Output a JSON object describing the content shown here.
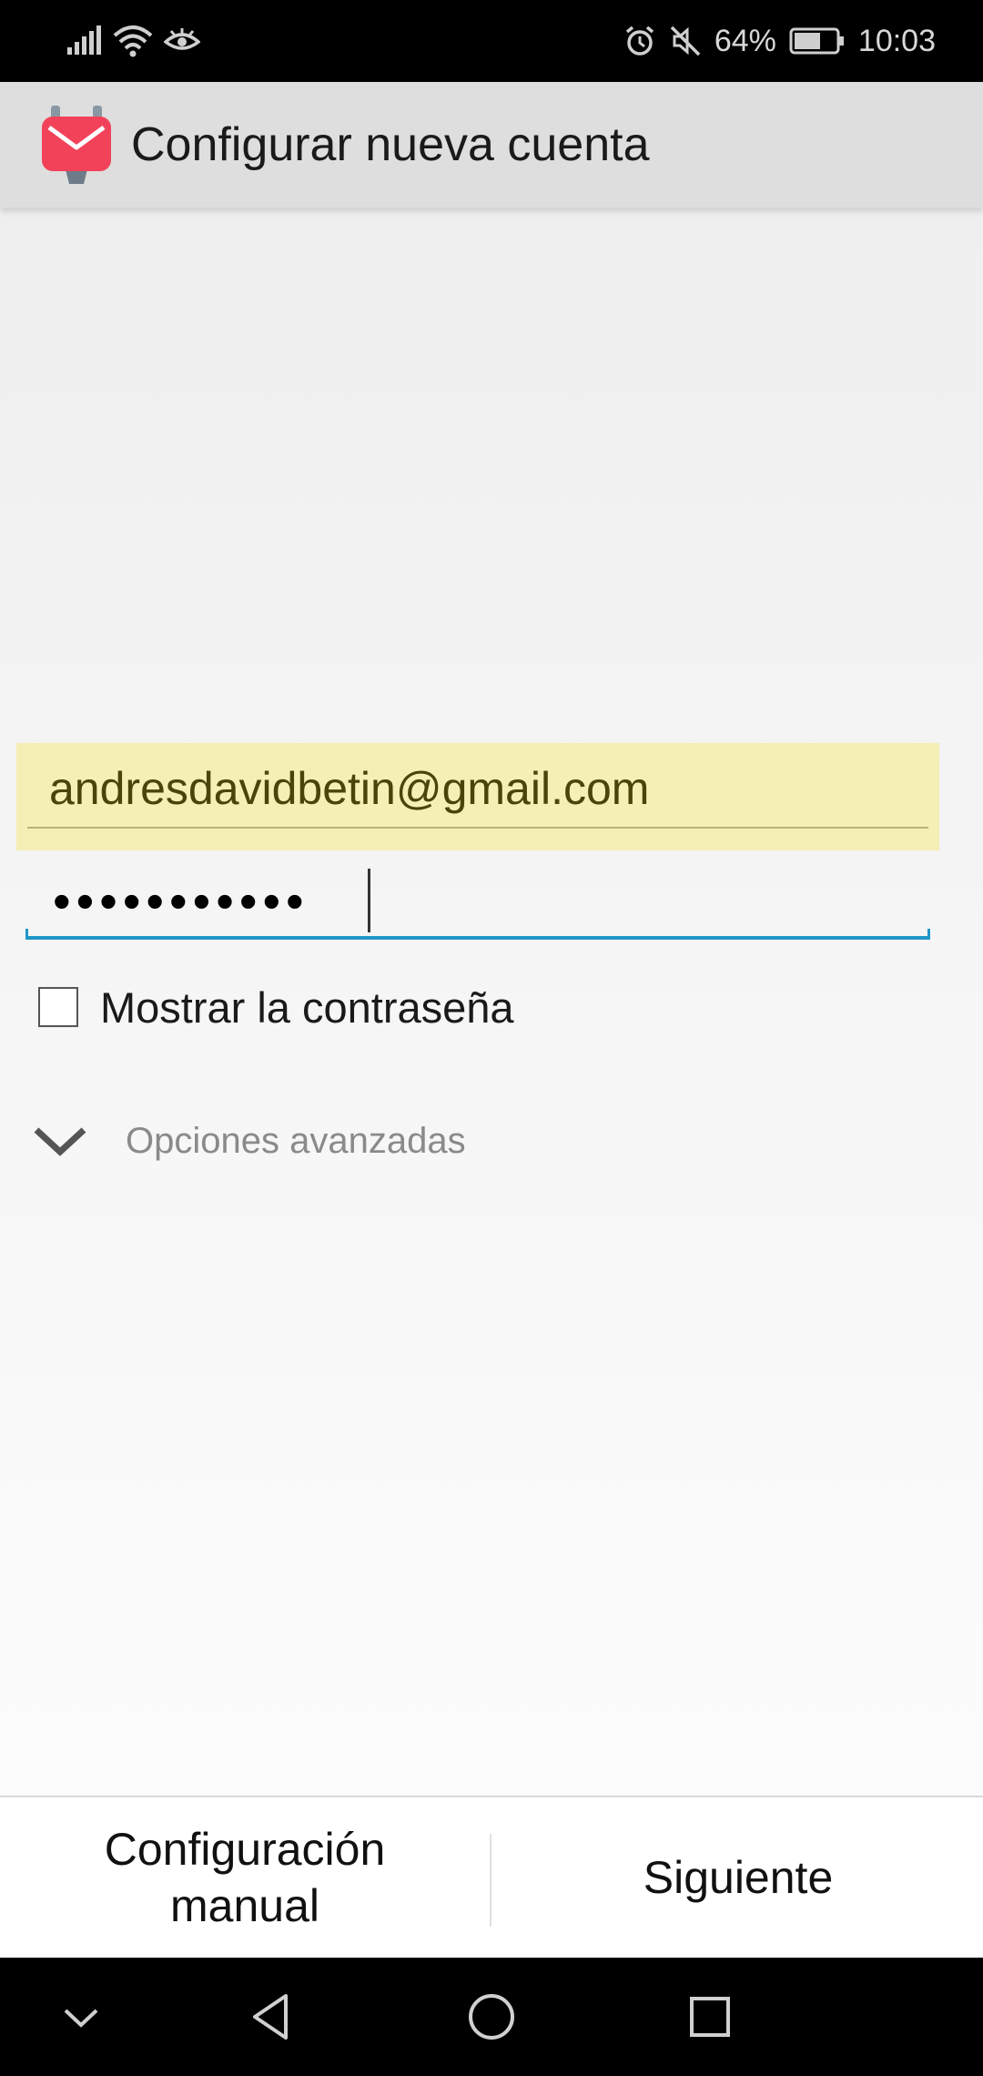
{
  "status_bar": {
    "battery_percent": "64%",
    "time": "10:03",
    "icons": [
      "signal-icon",
      "wifi-icon",
      "eye-icon",
      "alarm-icon",
      "mute-icon",
      "battery-icon"
    ],
    "battery_level": 0.64
  },
  "app_bar": {
    "title": "Configurar nueva cuenta",
    "logo_icon": "k9-mail-logo-icon",
    "logo_color": "#f2425a"
  },
  "form": {
    "email_value": "andresdavidbetin@gmail.com",
    "email_highlight_color": "#f4efb4",
    "password_masked": "•••••••••••",
    "password_length": 11,
    "accent_color": "#2196c8",
    "show_password_label": "Mostrar la contraseña",
    "show_password_checked": false,
    "advanced_label": "Opciones avanzadas",
    "advanced_icon": "chevron-down-icon"
  },
  "bottom_actions": {
    "manual_label": "Configuración\nmanual",
    "next_label": "Siguiente"
  },
  "nav_bar": {
    "icons": [
      "hide-keyboard-icon",
      "back-icon",
      "home-icon",
      "recents-icon"
    ]
  }
}
